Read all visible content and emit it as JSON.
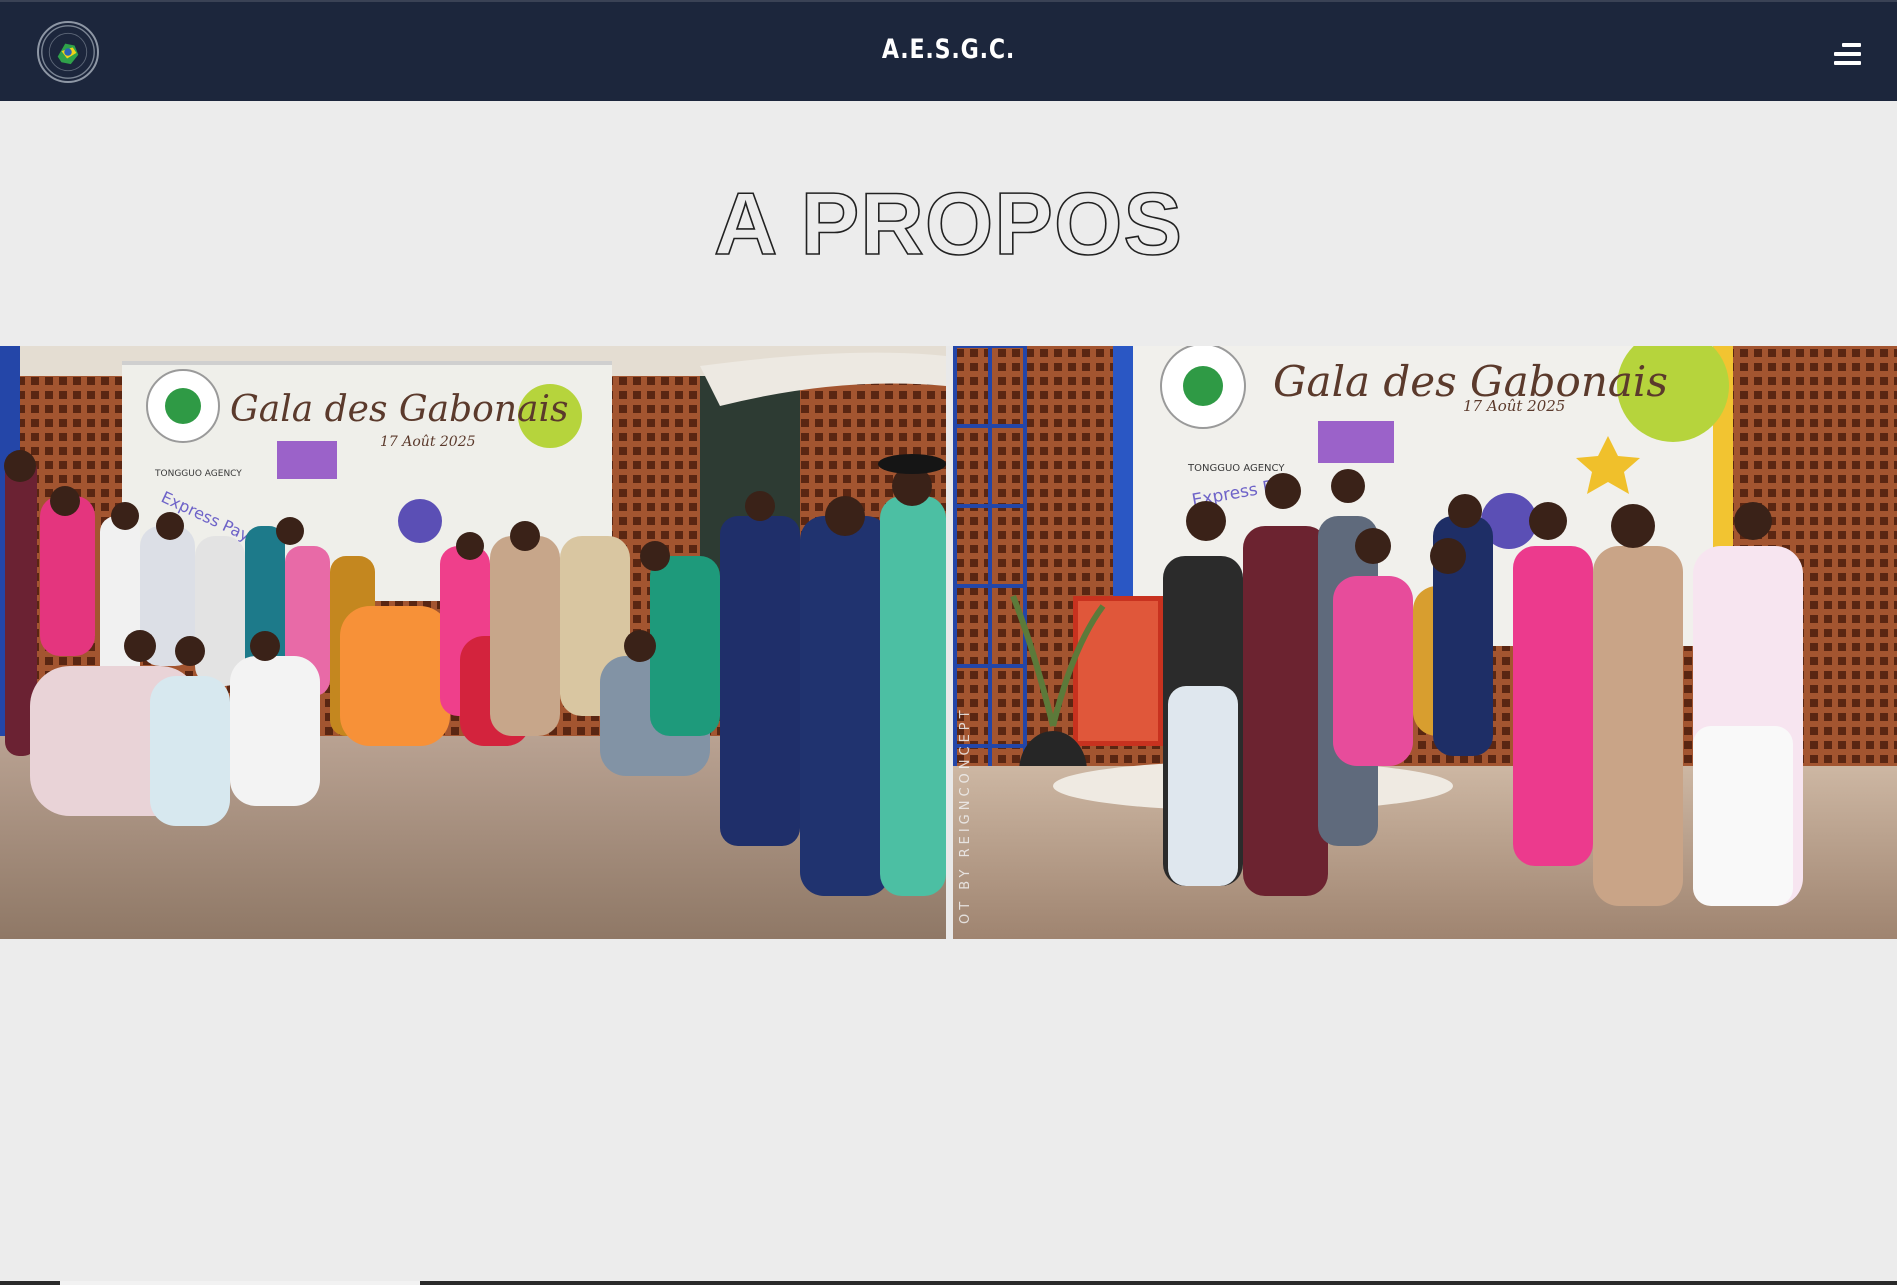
{
  "header": {
    "brand": "A.E.S.G.C.",
    "logo_icon": "association-emblem-icon",
    "menu_icon": "hamburger-menu-icon"
  },
  "hero": {
    "title": "A PROPOS"
  },
  "gallery": {
    "left_photo": {
      "banner_title": "Gala des Gabonais",
      "banner_date": "17 Août 2025",
      "banner_sponsor": "TONGGUO AGENCY",
      "banner_sponsor2": "Express Pay"
    },
    "right_photo": {
      "banner_title": "Gala des Gabonais",
      "banner_date": "17 Août 2025",
      "banner_sponsor": "TONGGUO AGENCY",
      "banner_sponsor2": "Express Pay",
      "watermark": "OT BY REIGNCONCEPT"
    },
    "progress": 0.19
  },
  "colors": {
    "navbar": "#1c263c",
    "page_background": "#ececec",
    "brick_wall": "#a5522e",
    "text_white": "#ffffff"
  }
}
